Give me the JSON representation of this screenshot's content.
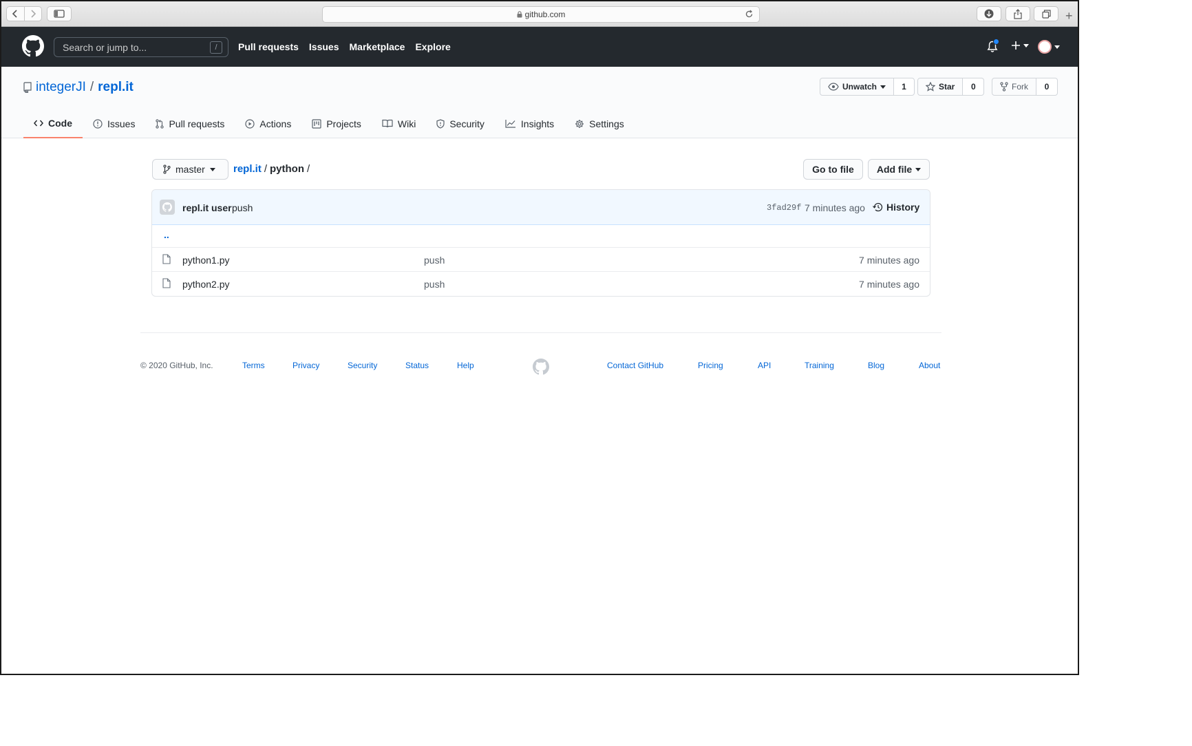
{
  "browser": {
    "url": "github.com"
  },
  "header": {
    "search_placeholder": "Search or jump to...",
    "search_shortcut": "/",
    "nav": [
      "Pull requests",
      "Issues",
      "Marketplace",
      "Explore"
    ]
  },
  "repo": {
    "owner": "integerJI",
    "separator": "/",
    "name": "repl.it",
    "watch_label": "Unwatch",
    "watch_count": "1",
    "star_label": "Star",
    "star_count": "0",
    "fork_label": "Fork",
    "fork_count": "0",
    "tabs": [
      "Code",
      "Issues",
      "Pull requests",
      "Actions",
      "Projects",
      "Wiki",
      "Security",
      "Insights",
      "Settings"
    ],
    "selected_tab": "Code"
  },
  "filenav": {
    "branch": "master",
    "breadcrumb_root": "repl.it",
    "breadcrumb_sep": "/",
    "breadcrumb_dir": "python",
    "breadcrumb_trailing": "/",
    "go_to_file": "Go to file",
    "add_file": "Add file"
  },
  "commit": {
    "author": "repl.it user",
    "message": "push",
    "sha": "3fad29f",
    "time": "7 minutes ago",
    "history_label": "History"
  },
  "files": {
    "up_dir": "..",
    "rows": [
      {
        "name": "python1.py",
        "message": "push",
        "age": "7 minutes ago"
      },
      {
        "name": "python2.py",
        "message": "push",
        "age": "7 minutes ago"
      }
    ]
  },
  "footer": {
    "copyright": "© 2020 GitHub, Inc.",
    "links": [
      "Terms",
      "Privacy",
      "Security",
      "Status",
      "Help",
      "Contact GitHub",
      "Pricing",
      "API",
      "Training",
      "Blog",
      "About"
    ]
  },
  "colors": {
    "header_bg": "#24292e",
    "link": "#0366d6",
    "tab_underline": "#f9826c",
    "commit_bg": "#f1f8ff",
    "notification_dot": "#2188ff"
  }
}
